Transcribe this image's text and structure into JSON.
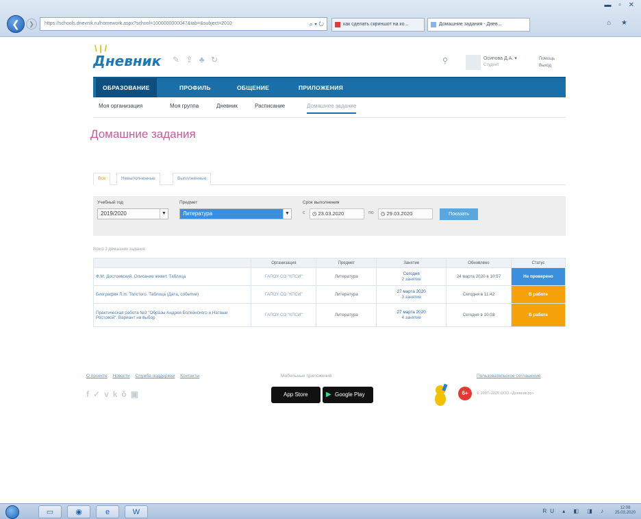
{
  "browser": {
    "url": "https://schools.dnevnik.ru/homework.aspx?school=1000000000047&tab=&subject=2010",
    "tabs": [
      {
        "label": "как сделать скриншот на ко..."
      },
      {
        "label": "Домашние задания - Днев..."
      }
    ]
  },
  "site": {
    "logo": "Дневник",
    "user": {
      "name": "Осипова Д.А.",
      "role": "Студент"
    },
    "help_link": "Помощь",
    "exit_link": "Выход"
  },
  "main_nav": [
    {
      "label": "ОБРАЗОВАНИЕ",
      "active": true
    },
    {
      "label": "ПРОФИЛЬ",
      "active": false
    },
    {
      "label": "ОБЩЕНИЕ",
      "active": false
    },
    {
      "label": "ПРИЛОЖЕНИЯ",
      "active": false
    }
  ],
  "sub_nav": [
    {
      "label": "Моя организация"
    },
    {
      "label": "Моя группа"
    },
    {
      "label": "Дневник"
    },
    {
      "label": "Расписание"
    },
    {
      "label": "Домашнее задание",
      "active": true
    }
  ],
  "page_title": "Домашние задания",
  "filter_tabs": [
    {
      "label": "Все",
      "active": true
    },
    {
      "label": "Невыполненные"
    },
    {
      "label": "Выполненные"
    }
  ],
  "filters": {
    "year_label": "Учебный год",
    "year_value": "2019/2020",
    "subject_label": "Предмет",
    "subject_value": "Литература",
    "deadline_label": "Срок выполнения",
    "from_prefix": "с",
    "from_date": "23.03.2020",
    "to_prefix": "по",
    "to_date": "29.03.2020",
    "show_button": "Показать"
  },
  "count_text": "Всего 3 домашних задания",
  "table": {
    "headers": [
      "",
      "Организация",
      "Предмет",
      "Занятие",
      "Обновлено",
      "Статус"
    ],
    "rows": [
      {
        "title": "Ф.М. Достоевский. Описание живет. Таблица",
        "org": "ГАПОУ СО \"КПСИ\"",
        "subject": "Литература",
        "lesson_date": "Сегодня",
        "lesson_num": "2 занятие",
        "updated": "24 марта 2020 в 10:57",
        "status": "Не проверено",
        "status_color": "#3b8fdc"
      },
      {
        "title": "Биография Л.Н. Толстого. Таблица (Дата, событие)",
        "org": "ГАПОУ СО \"КПСИ\"",
        "subject": "Литература",
        "lesson_date": "27 марта 2020",
        "lesson_num": "3 занятие",
        "updated": "Сегодня в 11:42",
        "status": "В работе",
        "status_color": "#f5a20a"
      },
      {
        "title": "Практическая работа №3 \"Образы Андрея Болконского и Наташи Ростовой\". Вариант на выбор",
        "org": "ГАПОУ СО \"КПСИ\"",
        "subject": "Литература",
        "lesson_date": "27 марта 2020",
        "lesson_num": "4 занятие",
        "updated": "Сегодня в 10:03",
        "status": "В работе",
        "status_color": "#f5a20a"
      }
    ]
  },
  "footer": {
    "links": [
      "О проекте",
      "Новости",
      "Служба поддержки",
      "Контакты"
    ],
    "mobile_label": "Мобильные приложения",
    "app_store": "App Store",
    "google_play": "Google Play",
    "age": "6+",
    "terms": "Пользовательское соглашение",
    "copyright": "© 2007–2020 ООО «Дневник.ру»"
  },
  "taskbar": {
    "clock_time": "12:08",
    "clock_date": "25.03.2020"
  }
}
